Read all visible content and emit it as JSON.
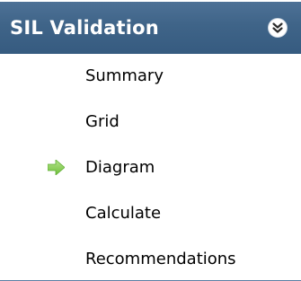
{
  "header": {
    "title": "SIL Validation",
    "collapse_icon": "double-chevron-down-icon"
  },
  "menu": {
    "items": [
      {
        "label": "Summary",
        "active": false
      },
      {
        "label": "Grid",
        "active": false
      },
      {
        "label": "Diagram",
        "active": true,
        "indicator_icon": "green-arrow-right-icon"
      },
      {
        "label": "Calculate",
        "active": false
      },
      {
        "label": "Recommendations",
        "active": false
      }
    ]
  },
  "colors": {
    "header_background": "#3f6488",
    "header_text": "#ffffff",
    "active_indicator": "#8fd05c",
    "divider": "#5b7ea3"
  }
}
